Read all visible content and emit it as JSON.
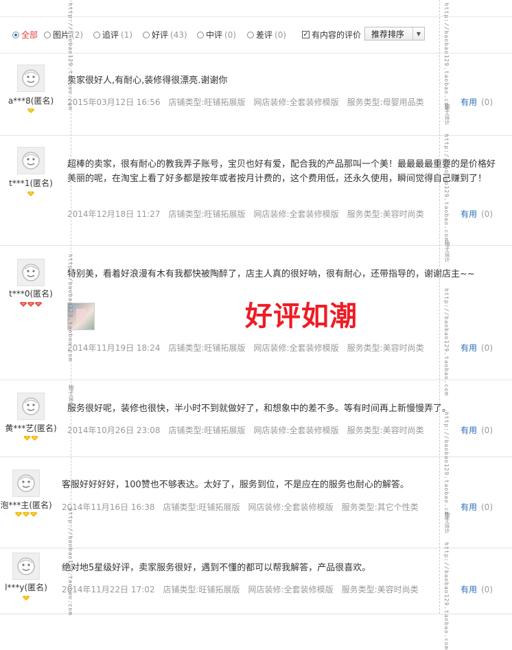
{
  "filters": {
    "options": [
      {
        "label": "全部",
        "count": "",
        "selected": true
      },
      {
        "label": "图片",
        "count": "(2)",
        "selected": false
      },
      {
        "label": "追评",
        "count": "(1)",
        "selected": false
      },
      {
        "label": "好评",
        "count": "(43)",
        "selected": false
      },
      {
        "label": "中评",
        "count": "(0)",
        "selected": false
      },
      {
        "label": "差评",
        "count": "(0)",
        "selected": false
      }
    ],
    "with_content_label": "有内容的评价",
    "with_content_checked": "✓",
    "sort_label": "推荐排序",
    "sort_arrow": "▼"
  },
  "promo_text": "好评如潮",
  "watermark": {
    "url": "http://baobao129.taobao.com",
    "brand": "柚子设计"
  },
  "colors": {
    "accent": "#e4393c",
    "link": "#2a6ebd",
    "promo": "#ee1c25",
    "gem": "#f2b600"
  },
  "reviews": [
    {
      "user": "a***8(匿名)",
      "gems": 1,
      "gem_color": "#f2b600",
      "text": "卖家很好人,有耐心,装修得很漂亮.谢谢你",
      "date": "2015年03月12日 16:56",
      "shop_type": "店铺类型:旺铺拓展版",
      "decor": "网店装修:全套装修模版",
      "service": "服务类型:母婴用品类",
      "useful_label": "有用",
      "useful_count": "(0)"
    },
    {
      "user": "t***1(匿名)",
      "gems": 1,
      "gem_color": "#f2b600",
      "text": "超棒的卖家，很有耐心的教我弄子账号，宝贝也好有爱，配合我的产品那叫一个美！最最最最重要的是价格好美丽的呢，在淘宝上看了好多都是按年或者按月计费的，这个费用低，还永久使用，瞬间觉得自己赚到了！",
      "date": "2014年12月18日 11:27",
      "shop_type": "店铺类型:旺铺拓展版",
      "decor": "网店装修:全套装修模版",
      "service": "服务类型:美容时尚类",
      "useful_label": "有用",
      "useful_count": "(0)"
    },
    {
      "user": "t***0(匿名)",
      "gems": 3,
      "gem_color": "#e8463c",
      "text": "特别美，看着好浪漫有木有我都快被陶醉了，店主人真的很好呐，很有耐心，还带指导的，谢谢店主~~",
      "date": "2014年11月19日 18:24",
      "shop_type": "店铺类型:旺铺拓展版",
      "decor": "网店装修:全套装修模版",
      "service": "服务类型:美容时尚类",
      "useful_label": "有用",
      "useful_count": "(0)"
    },
    {
      "user": "黄***艺(匿名)",
      "gems": 2,
      "gem_color": "#f2b600",
      "text": "服务很好呢，装修也很快，半小时不到就做好了，和想象中的差不多。等有时间再上新慢慢弄了。",
      "date": "2014年10月26日 23:08",
      "shop_type": "店铺类型:旺铺拓展版",
      "decor": "网店装修:全套装修模版",
      "service": "服务类型:美容时尚类",
      "useful_label": "有用",
      "useful_count": "(0)"
    },
    {
      "user": "泡***主(匿名)",
      "gems": 3,
      "gem_color": "#f2b600",
      "text": "客服好好好好，100赞也不够表达。太好了，服务到位，不是应在的服务也耐心的解答。",
      "date": "2014年11月16日 16:38",
      "shop_type": "店铺类型:旺铺拓展版",
      "decor": "网店装修:全套装修模版",
      "service": "服务类型:其它个性类",
      "useful_label": "有用",
      "useful_count": "(0)"
    },
    {
      "user": "l***y(匿名)",
      "gems": 1,
      "gem_color": "#f2b600",
      "text": "绝对地5星级好评，卖家服务很好，遇到不懂的都可以帮我解答，产品很喜欢。",
      "date": "2014年11月22日 17:02",
      "shop_type": "店铺类型:旺铺拓展版",
      "decor": "网店装修:全套装修模版",
      "service": "服务类型:美容时尚类",
      "useful_label": "有用",
      "useful_count": "(0)"
    }
  ]
}
